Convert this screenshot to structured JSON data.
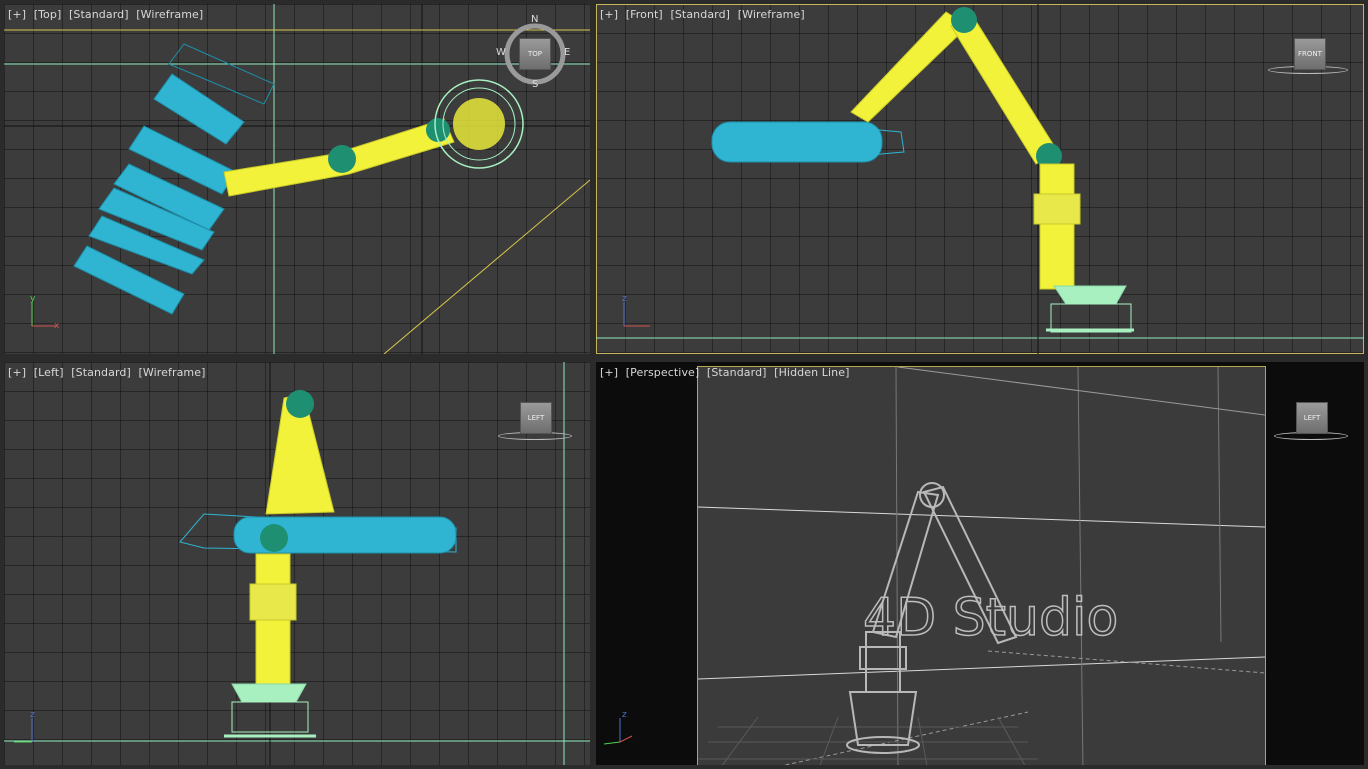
{
  "viewports": {
    "top": {
      "label": {
        "plus": "[+]",
        "view": "[Top]",
        "shading": "[Standard]",
        "mode": "[Wireframe]"
      },
      "compass": {
        "n": "N",
        "s": "S",
        "e": "E",
        "w": "W"
      },
      "viewcube": "TOP"
    },
    "front": {
      "label": {
        "plus": "[+]",
        "view": "[Front]",
        "shading": "[Standard]",
        "mode": "[Wireframe]"
      },
      "viewcube": "FRONT"
    },
    "left": {
      "label": {
        "plus": "[+]",
        "view": "[Left]",
        "shading": "[Standard]",
        "mode": "[Wireframe]"
      },
      "viewcube": "LEFT"
    },
    "perspective": {
      "label": {
        "plus": "[+]",
        "view": "[Perspective]",
        "shading": "[Standard]",
        "mode": "[Hidden Line]"
      },
      "viewcube": "LEFT",
      "watermark": "4D Studio"
    }
  },
  "axes": {
    "x": "x",
    "y": "y",
    "z": "z"
  },
  "colors": {
    "grid_bg": "#3c3c3c",
    "wire_yellow": "#f2f23a",
    "wire_cyan": "#2fb4d2",
    "joint_teal": "#1f8f72",
    "base_mint": "#a8f0c0",
    "active_border": "#c8b45a"
  }
}
